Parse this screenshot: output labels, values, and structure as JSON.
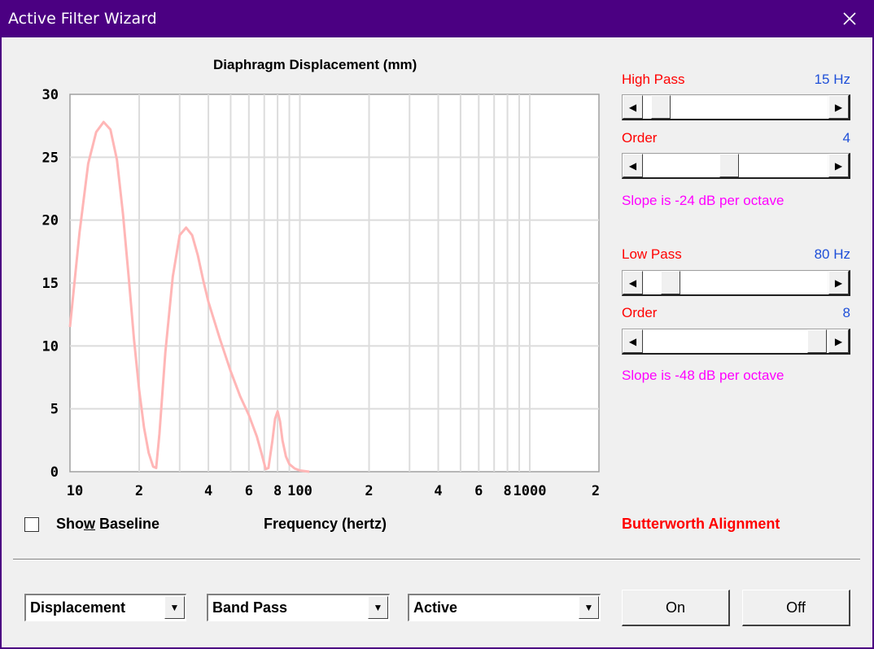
{
  "window": {
    "title": "Active Filter Wizard"
  },
  "chart_data": {
    "type": "line",
    "title": "Diaphragm Displacement (mm)",
    "xlabel": "Frequency (hertz)",
    "ylabel": "",
    "xscale": "log",
    "xlim": [
      10,
      2000
    ],
    "ylim": [
      0,
      30
    ],
    "yticks": [
      "30",
      "25",
      "20",
      "15",
      "10",
      "5",
      "0"
    ],
    "xticks": [
      "10",
      "2",
      "4",
      "6",
      "8",
      "100",
      "2",
      "4",
      "6",
      "8",
      "1000",
      "2"
    ],
    "grid": true,
    "line_color": "#ffb6b6",
    "series": [
      {
        "x": [
          10,
          11,
          12,
          13,
          14,
          15,
          16,
          17,
          18,
          19,
          20,
          21,
          22,
          23,
          23.7,
          24.5,
          26,
          28,
          30,
          32,
          34,
          36,
          38,
          40,
          45,
          50,
          55,
          60,
          65,
          68,
          71,
          73,
          76,
          78,
          80,
          82,
          84,
          87,
          90,
          95,
          100,
          110
        ],
        "y": [
          11.5,
          19,
          24.5,
          27,
          27.8,
          27.2,
          24.8,
          20.5,
          15.5,
          10.5,
          6.5,
          3.5,
          1.5,
          0.4,
          0.3,
          3,
          9.5,
          15.5,
          18.8,
          19.4,
          18.8,
          17.2,
          15.2,
          13.5,
          10.5,
          8,
          6,
          4.5,
          2.8,
          1.5,
          0.2,
          0.3,
          2.5,
          4.2,
          4.8,
          4,
          2.5,
          1.2,
          0.6,
          0.25,
          0.1,
          0
        ]
      }
    ]
  },
  "controls": {
    "high_pass_label": "High Pass",
    "high_pass_value": "15 Hz",
    "high_pass_level": 0.04,
    "hp_order_label": "Order",
    "hp_order_value": "4",
    "hp_order_level": 0.46,
    "hp_slope": "Slope is -24 dB per octave",
    "low_pass_label": "Low Pass",
    "low_pass_value": "80 Hz",
    "low_pass_level": 0.1,
    "lp_order_label": "Order",
    "lp_order_value": "8",
    "lp_order_level": 1.0,
    "lp_slope": "Slope is -48 dB per octave"
  },
  "baseline": {
    "label_pre": "Sho",
    "label_u": "w",
    "label_post": " Baseline",
    "checked": false
  },
  "alignment": "Butterworth Alignment",
  "selects": {
    "mode": "Displacement",
    "filter_type": "Band Pass",
    "filter_kind": "Active"
  },
  "buttons": {
    "on": "On",
    "off": "Off"
  },
  "colors": {
    "title_bar": "#4b0082",
    "curve": "#ffb6b6",
    "label_red": "#ff0000",
    "value_blue": "#1e4fd8",
    "slope_magenta": "#ff00ff"
  }
}
